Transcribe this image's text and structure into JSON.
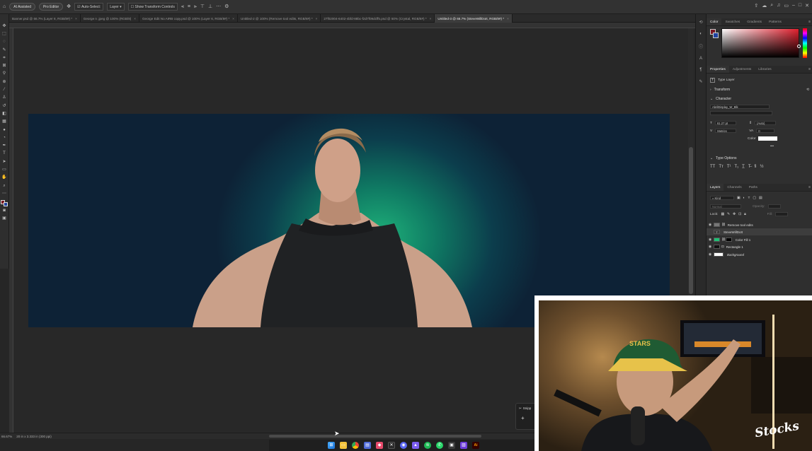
{
  "options_bar": {
    "ai_assisted": "AI Assisted",
    "pro_editor": "Pro Editor",
    "auto_select": "Auto-Select:",
    "auto_select_target": "Layer",
    "show_transform": "Show Transform Controls"
  },
  "tabs": [
    {
      "label": "Banner.psd @ 66.7% (Layer 8, RGB/8#) *",
      "active": false
    },
    {
      "label": "George n .jpeg @ 100% (RGB/8)",
      "active": false
    },
    {
      "label": "George Edit No AIRB copy.psd @ 100% (Layer 6, RGB/8#) *",
      "active": false
    },
    {
      "label": "Untitled-2 @ 100% (Remove tool edits, RGB/8#) *",
      "active": false
    },
    {
      "label": "27f02004-6402-4bfd-88bc-f2d7f09dcff5.psd @ 50% (Crystal, RGB/8#) *",
      "active": false
    },
    {
      "label": "Untitled-3 @ 66.7% (SteveWillDoIt, RGB/8#) *",
      "active": true
    }
  ],
  "status_bar": {
    "zoom": "66.67%",
    "doc_size": "20 in x 3.333 in (300 ppi)"
  },
  "color_panel": {
    "tabs": [
      "Color",
      "Swatches",
      "Gradients",
      "Patterns"
    ],
    "foreground": "#7a1520",
    "background": "#2143a0"
  },
  "properties_panel": {
    "tabs": [
      "Properties",
      "Adjustments",
      "Libraries"
    ],
    "layer_type": "Type Layer",
    "transform": "Transform",
    "character": "Character",
    "font_family": "AbrilDisplay_W_Blk",
    "font_size": "61.27 pt",
    "leading": "(Auto)",
    "kerning": "Metrics",
    "tracking": "0",
    "color_label": "Color",
    "text_color": "#ffffff",
    "type_options": "Type Options"
  },
  "layers_panel": {
    "tabs": [
      "Layers",
      "Channels",
      "Paths"
    ],
    "filter_kind": "Kind",
    "blend_mode": "Normal",
    "opacity_label": "Opacity:",
    "lock_label": "Lock:",
    "fill_label": "Fill:",
    "layers": [
      {
        "name": "Remove tool edits",
        "visible": true,
        "selected": false,
        "thumb": "#777777"
      },
      {
        "name": "SteveWillDoIt",
        "visible": false,
        "selected": true,
        "thumb": "#3a3a3a"
      },
      {
        "name": "Color Fill 1",
        "visible": true,
        "selected": false,
        "thumb": "#1fbf74"
      },
      {
        "name": "Rectangle 1",
        "visible": true,
        "selected": false,
        "thumb": "#111111"
      },
      {
        "name": "Background",
        "visible": true,
        "selected": false,
        "thumb": "#ffffff"
      }
    ]
  },
  "snip_popup": {
    "label": "Snipp"
  },
  "webcam": {
    "cap_text": "STARS",
    "signature": "Stocks"
  },
  "icons": {
    "taskbar": [
      "windows-icon",
      "file-explorer-icon",
      "chrome-icon",
      "app-icon",
      "app-icon",
      "app-icon",
      "discord-icon",
      "app-icon",
      "spotify-icon",
      "whatsapp-icon",
      "app-icon",
      "app-icon",
      "illustrator-icon"
    ]
  }
}
